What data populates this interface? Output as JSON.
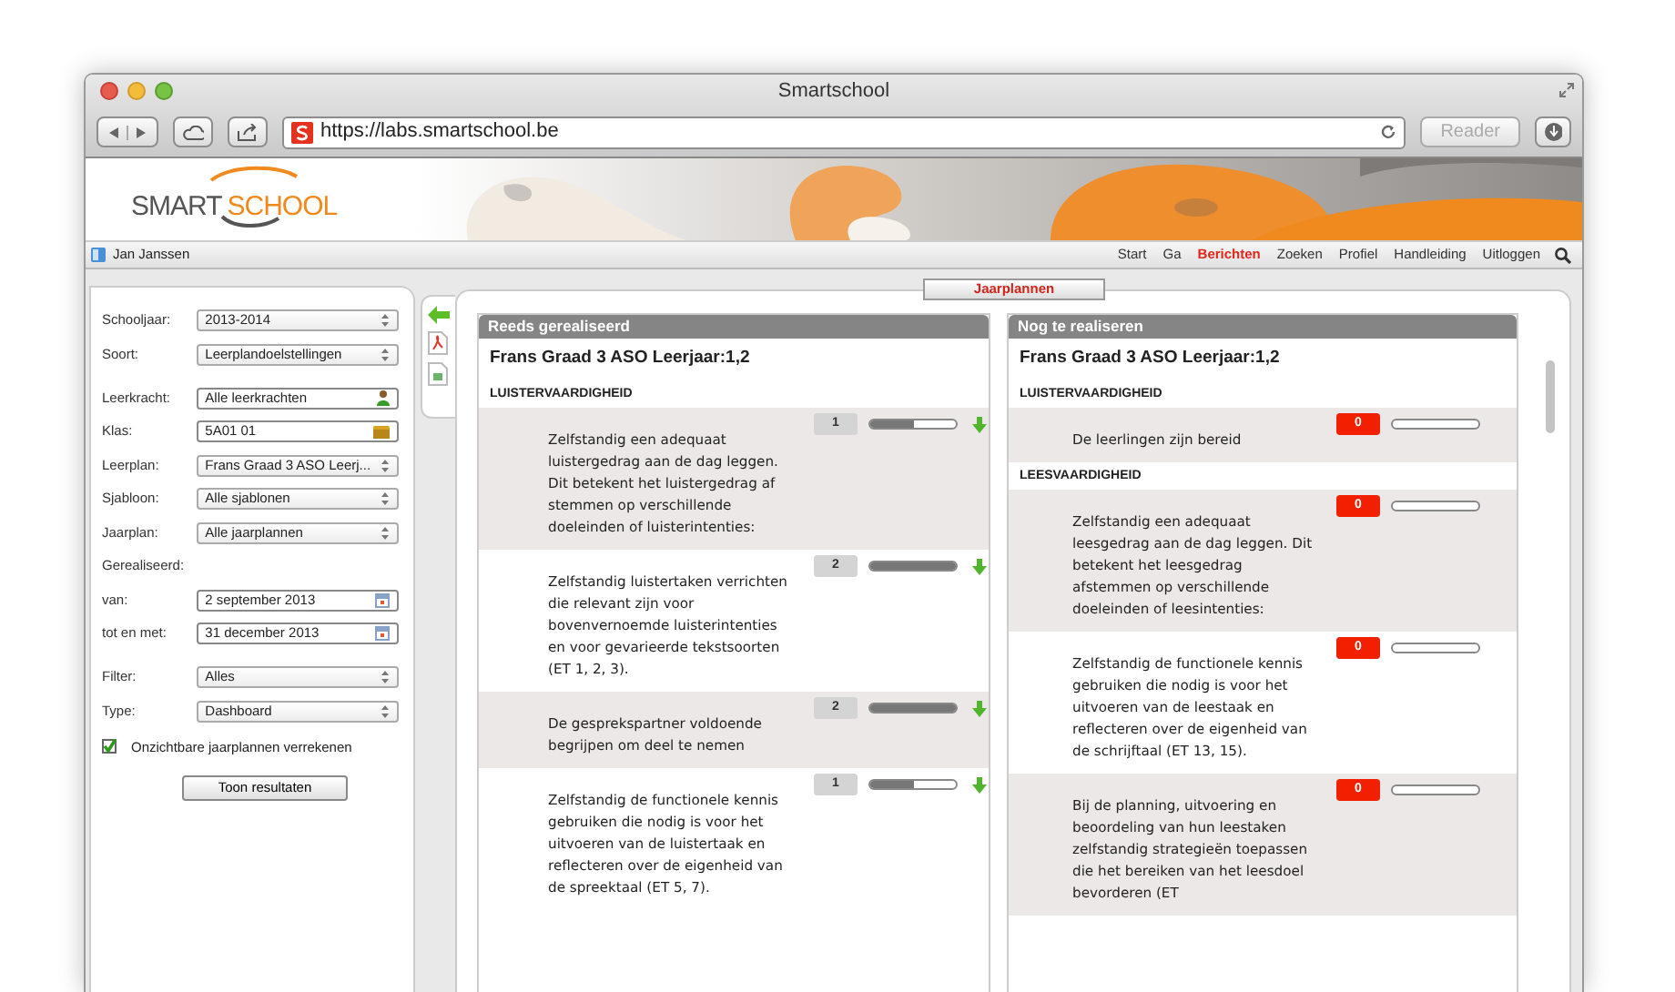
{
  "window": {
    "title": "Smartschool"
  },
  "toolbar": {
    "url": "https://labs.smartschool.be",
    "reader": "Reader"
  },
  "logo": {
    "first": "SMART",
    "second": "SCHOOL"
  },
  "user": {
    "name": "Jan Janssen"
  },
  "nav": [
    {
      "label": "Start",
      "selected": false
    },
    {
      "label": "Ga",
      "selected": false
    },
    {
      "label": "Berichten",
      "selected": true
    },
    {
      "label": "Zoeken",
      "selected": false
    },
    {
      "label": "Profiel",
      "selected": false
    },
    {
      "label": "Handleiding",
      "selected": false
    },
    {
      "label": "Uitloggen",
      "selected": false
    }
  ],
  "filter_groups": [
    [
      {
        "kind": "select",
        "label": "Schooljaar:",
        "value": "2013-2014"
      },
      {
        "kind": "select",
        "label": "Soort:",
        "value": "Leerplandoelstellingen"
      }
    ],
    [
      {
        "kind": "person",
        "label": "Leerkracht:",
        "value": "Alle leerkrachten"
      },
      {
        "kind": "folder",
        "label": "Klas:",
        "value": "5A01 01"
      },
      {
        "kind": "select",
        "label": "Leerplan:",
        "value": "Frans Graad 3 ASO Leerj..."
      },
      {
        "kind": "select",
        "label": "Sjabloon:",
        "value": "Alle sjablonen"
      },
      {
        "kind": "select",
        "label": "Jaarplan:",
        "value": "Alle jaarplannen"
      },
      {
        "kind": "heading",
        "label": "Gerealiseerd:"
      },
      {
        "kind": "date",
        "label": "van:",
        "value": "2 september 2013"
      },
      {
        "kind": "date",
        "label": "tot en met:",
        "value": "31 december 2013"
      }
    ],
    [
      {
        "kind": "select",
        "label": "Filter:",
        "value": "Alles"
      },
      {
        "kind": "select",
        "label": "Type:",
        "value": "Dashboard"
      }
    ]
  ],
  "checkbox": {
    "label": "Onzichtbare jaarplannen verrekenen",
    "checked": true
  },
  "submit": "Toon resultaten",
  "tab": {
    "label": "Jaarplannen",
    "selected": true
  },
  "columns": [
    {
      "kind": "realized",
      "title": "Reeds gerealiseerd",
      "subtitle": "Frans Graad 3 ASO Leerjaar:1,2",
      "sections": [
        {
          "heading": "LUISTERVAARDIGHEID",
          "items": [
            {
              "text": "Zelfstandig een adequaat luistergedrag aan de dag leggen. Dit betekent het luistergedrag af stemmen op verschillende doeleinden of luisterintenties:",
              "count": "1",
              "level": 0.5
            },
            {
              "text": "Zelfstandig luistertaken verrichten die relevant zijn voor bovenvernoemde luisterintenties en voor gevarieerde tekstsoorten (ET 1, 2, 3).",
              "count": "2",
              "level": 1
            },
            {
              "text": "De gesprekspartner voldoende begrijpen om deel te nemen",
              "count": "2",
              "level": 1
            },
            {
              "text": "Zelfstandig de functionele kennis gebruiken die nodig is voor het uitvoeren van de luistertaak en reflecteren over de eigenheid van de spreektaal (ET 5, 7).",
              "count": "1",
              "level": 0.5
            }
          ]
        }
      ]
    },
    {
      "kind": "pending",
      "title": "Nog te realiseren",
      "subtitle": "Frans Graad 3 ASO Leerjaar:1,2",
      "sections": [
        {
          "heading": "LUISTERVAARDIGHEID",
          "items": [
            {
              "text": "De leerlingen zijn bereid",
              "count": "0",
              "level": 0
            }
          ]
        },
        {
          "heading": "LEESVAARDIGHEID",
          "items": [
            {
              "text": "Zelfstandig een adequaat leesgedrag aan de dag leggen. Dit betekent het leesgedrag afstemmen op verschillende doeleinden of leesintenties:",
              "count": "0",
              "level": 0
            },
            {
              "text": "Zelfstandig de functionele kennis gebruiken die nodig is voor het uitvoeren van de leestaak en reflecteren over de eigenheid van de schrijftaal (ET 13, 15).",
              "count": "0",
              "level": 0
            },
            {
              "text": "Bij de planning, uitvoering en beoordeling van hun leestaken zelfstandig strategieën toepassen die het bereiken van het leesdoel bevorderen (ET",
              "count": "0",
              "level": 0
            }
          ]
        }
      ]
    }
  ]
}
